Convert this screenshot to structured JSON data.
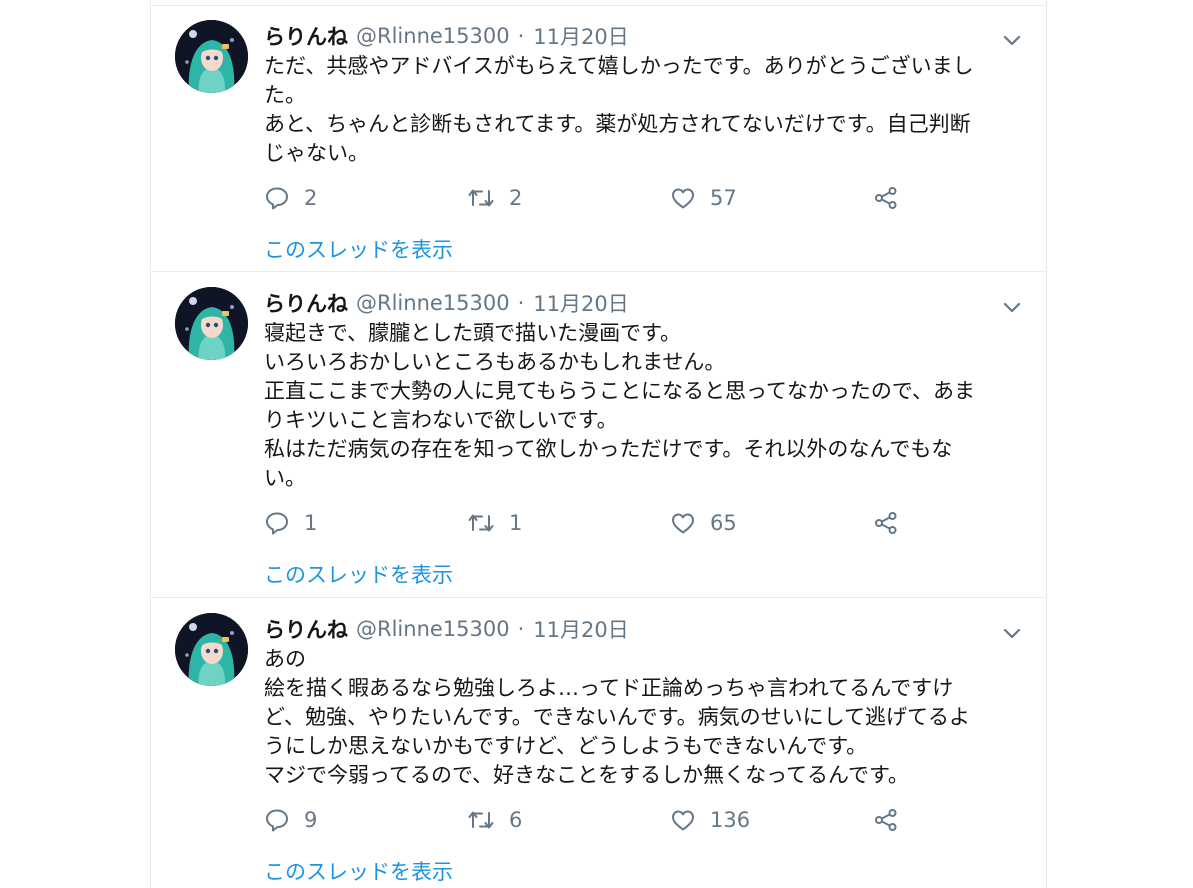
{
  "tweets": [
    {
      "name": "らりんね",
      "handle": "@Rlinne15300",
      "separator": "·",
      "date": "11月20日",
      "lines": [
        "ただ、共感やアドバイスがもらえて嬉しかったです。ありがとうございまし",
        "た。",
        "あと、ちゃんと診断もされてます。薬が処方されてないだけです。自己判断",
        "じゃない。"
      ],
      "replies": "2",
      "retweets": "2",
      "likes": "57",
      "thread_link": "このスレッドを表示"
    },
    {
      "name": "らりんね",
      "handle": "@Rlinne15300",
      "separator": "·",
      "date": "11月20日",
      "lines": [
        "寝起きで、朦朧とした頭で描いた漫画です。",
        "いろいろおかしいところもあるかもしれません。",
        "正直ここまで大勢の人に見てもらうことになると思ってなかったので、あま",
        "りキツいこと言わないで欲しいです。",
        "私はただ病気の存在を知って欲しかっただけです。それ以外のなんでもな",
        "い。"
      ],
      "replies": "1",
      "retweets": "1",
      "likes": "65",
      "thread_link": "このスレッドを表示"
    },
    {
      "name": "らりんね",
      "handle": "@Rlinne15300",
      "separator": "·",
      "date": "11月20日",
      "lines": [
        "あの",
        "絵を描く暇あるなら勉強しろよ…ってド正論めっちゃ言われてるんですけ",
        "ど、勉強、やりたいんです。できないんです。病気のせいにして逃げてるよ",
        "うにしか思えないかもですけど、どうしようもできないんです。",
        "マジで今弱ってるので、好きなことをするしか無くなってるんです。"
      ],
      "replies": "9",
      "retweets": "6",
      "likes": "136",
      "thread_link": "このスレッドを表示"
    }
  ],
  "icons": {
    "avatar": "anime-girl-avatar",
    "caret": "chevron-down-icon",
    "reply": "reply-icon",
    "retweet": "retweet-icon",
    "like": "heart-icon",
    "share": "share-icon"
  },
  "colors": {
    "link": "#1b95e0",
    "secondary_text": "#657786",
    "primary_text": "#14171a",
    "border": "#e6ecf0"
  }
}
